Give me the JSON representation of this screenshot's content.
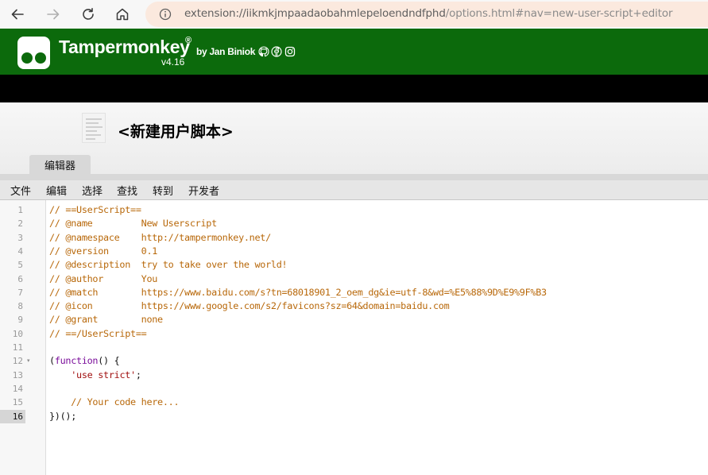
{
  "browser": {
    "url_host": "extension://iikmkjmpaadaobahmlepeloendndfphd",
    "url_rest": "/options.html#nav=new-user-script+editor",
    "buttons": [
      "back-icon",
      "forward-icon",
      "reload-icon",
      "home-icon",
      "info-icon"
    ]
  },
  "header": {
    "app_name": "Tampermonkey",
    "registered": "®",
    "version": "v4.16",
    "author": "by Jan Biniok",
    "social_icons": [
      "github-icon",
      "facebook-icon",
      "instagram-icon"
    ],
    "brand_color": "#0c6a0c"
  },
  "page": {
    "title": "<新建用户脚本>",
    "tabs": [
      {
        "label": "编辑器"
      }
    ]
  },
  "menu": {
    "items": [
      {
        "label": "文件"
      },
      {
        "label": "编辑"
      },
      {
        "label": "选择"
      },
      {
        "label": "查找"
      },
      {
        "label": "转到"
      },
      {
        "label": "开发者"
      }
    ]
  },
  "editor": {
    "active_line": "16",
    "fold_marker": "▾",
    "lines": [
      {
        "num": "1",
        "segments": [
          {
            "t": "// ==UserScript==",
            "c": "comment"
          }
        ]
      },
      {
        "num": "2",
        "segments": [
          {
            "t": "// @name         New Userscript",
            "c": "comment"
          }
        ]
      },
      {
        "num": "3",
        "segments": [
          {
            "t": "// @namespace    http://tampermonkey.net/",
            "c": "comment"
          }
        ]
      },
      {
        "num": "4",
        "segments": [
          {
            "t": "// @version      0.1",
            "c": "comment"
          }
        ]
      },
      {
        "num": "5",
        "segments": [
          {
            "t": "// @description  try to take over the world!",
            "c": "comment"
          }
        ]
      },
      {
        "num": "6",
        "segments": [
          {
            "t": "// @author       You",
            "c": "comment"
          }
        ]
      },
      {
        "num": "7",
        "segments": [
          {
            "t": "// @match        https://www.baidu.com/s?tn=68018901_2_oem_dg&ie=utf-8&wd=%E5%88%9D%E9%9F%B3",
            "c": "comment"
          }
        ]
      },
      {
        "num": "8",
        "segments": [
          {
            "t": "// @icon         https://www.google.com/s2/favicons?sz=64&domain=baidu.com",
            "c": "comment"
          }
        ]
      },
      {
        "num": "9",
        "segments": [
          {
            "t": "// @grant        none",
            "c": "comment"
          }
        ]
      },
      {
        "num": "10",
        "segments": [
          {
            "t": "// ==/UserScript==",
            "c": "comment"
          }
        ]
      },
      {
        "num": "11",
        "segments": []
      },
      {
        "num": "12",
        "segments": [
          {
            "t": "(",
            "c": "black"
          },
          {
            "t": "function",
            "c": "keyword"
          },
          {
            "t": "() {",
            "c": "black"
          }
        ]
      },
      {
        "num": "13",
        "segments": [
          {
            "t": "    ",
            "c": "black"
          },
          {
            "t": "'use strict'",
            "c": "string"
          },
          {
            "t": ";",
            "c": "black"
          }
        ]
      },
      {
        "num": "14",
        "segments": []
      },
      {
        "num": "15",
        "segments": [
          {
            "t": "    // Your code here...",
            "c": "comment"
          }
        ]
      },
      {
        "num": "16",
        "segments": [
          {
            "t": "})();",
            "c": "black"
          }
        ]
      }
    ]
  }
}
